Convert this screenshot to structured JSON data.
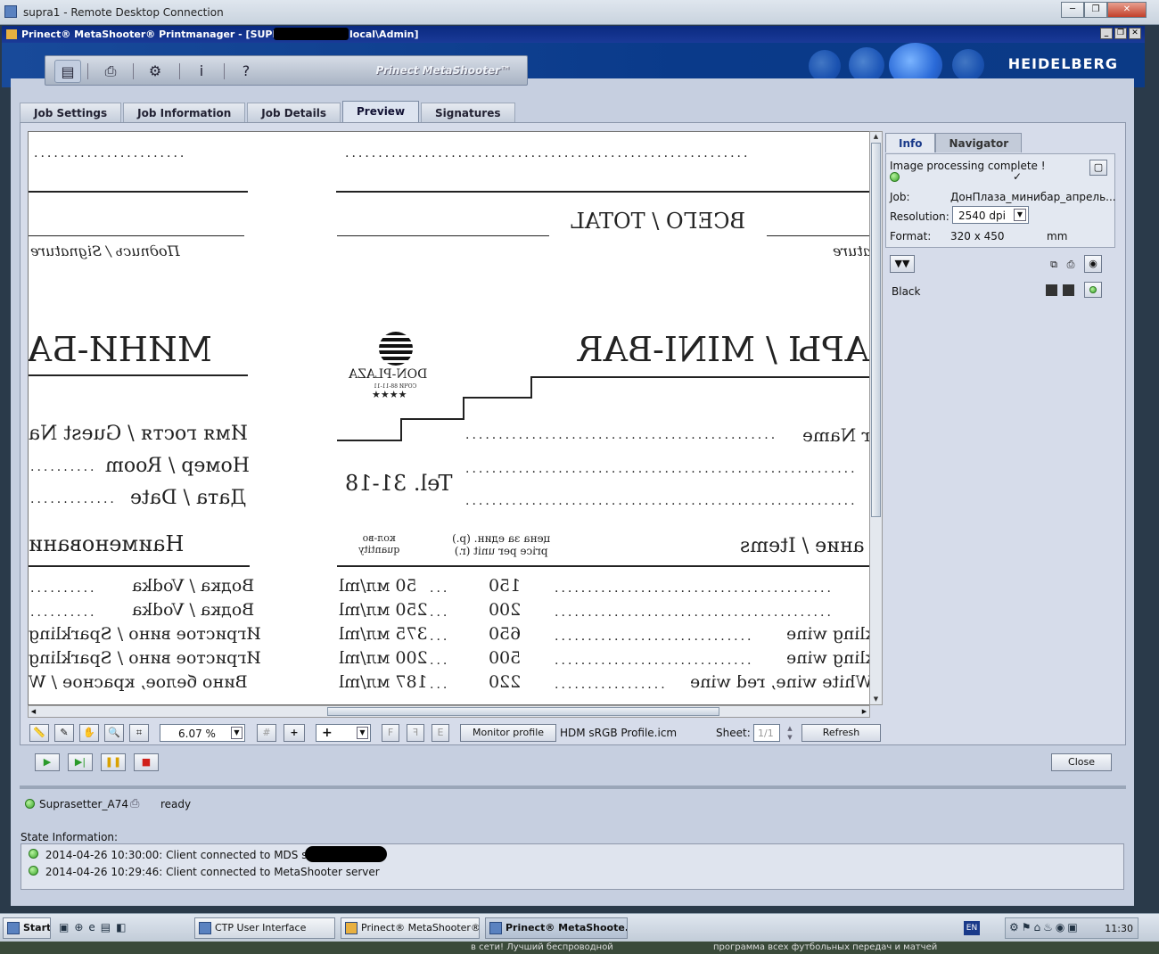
{
  "rdp": {
    "title": "supra1 - Remote Desktop Connection"
  },
  "app": {
    "title": "Prinect® MetaShooter® Printmanager - [SUPRA1/",
    "title_suffix": "local\\Admin]"
  },
  "banner": {
    "brand": "Prinect MetaShooter™",
    "logo": "HEIDELBERG"
  },
  "tabs": [
    "Job Settings",
    "Job Information",
    "Job Details",
    "Preview",
    "Signatures"
  ],
  "active_tab": "Preview",
  "preview_doc": {
    "total": "ВСЕГО / TOTAL",
    "signature": "Подпись / Signature",
    "signature_right": "ature",
    "minibar_left": "МИНИ-БА",
    "minibar_right": "САРЫ / MINI-BAR",
    "logo_text": "DON-PLAZA",
    "logo_sub": "СОЧИ 88-11-11",
    "stars": "★★★★",
    "guest": "Имя гостя / Guest Na",
    "guest_right": "r Name",
    "room": "Номер / Room",
    "date": "Дата / Date",
    "tel": "Tel. 31-18",
    "items_left": "Наименовани",
    "qty_header": [
      "кол-во",
      "quantity"
    ],
    "price_header": [
      "цена за един. (р.)",
      "price per unit (r.)"
    ],
    "items_right": "ание / Items",
    "lines": [
      {
        "left": "Водка / Vodka",
        "qty": "50 мл/ml",
        "price": "150",
        "right": ""
      },
      {
        "left": "Водка / Vodka",
        "qty": "250 мл/ml",
        "price": "200",
        "right": ""
      },
      {
        "left": "Игристое вино / Sparkling",
        "qty": "375 мл/ml",
        "price": "650",
        "right": "kling wine"
      },
      {
        "left": "Игристое вино / Sparkling",
        "qty": "200 мл/ml",
        "price": "500",
        "right": "kling wine"
      },
      {
        "left": "Вино белое, красное / W",
        "qty": "187 мл/ml",
        "price": "220",
        "right": "/ White wine, red wine"
      }
    ]
  },
  "side": {
    "tabs": [
      "Info",
      "Navigator"
    ],
    "status": "Image processing complete !",
    "job_label": "Job:",
    "job_value": "ДонПлаза_минибар_апрель...",
    "res_label": "Resolution:",
    "res_value": "2540 dpi",
    "format_label": "Format:",
    "format_value": "320 x 450",
    "format_unit": "mm",
    "separation": "Black"
  },
  "bottom": {
    "zoom": "6.07 %",
    "monitor_btn": "Monitor profile",
    "profile": "HDM sRGB Profile.icm",
    "sheet_label": "Sheet:",
    "sheet_value": "1/1",
    "refresh": "Refresh",
    "add": "+"
  },
  "close": "Close",
  "device": {
    "name": "Suprasetter_A74",
    "state": "ready"
  },
  "state_label": "State Information:",
  "log": [
    "2014-04-26 10:30:00: Client connected to MDS server",
    "2014-04-26 10:29:46: Client connected to MetaShooter server"
  ],
  "taskbar": {
    "start": "Start",
    "items": [
      "CTP User Interface",
      "Prinect® MetaShooter®...",
      "Prinect® MetaShoote..."
    ],
    "lang": "EN",
    "clock": "11:30"
  },
  "bg_text": [
    "в сети! Лучший беспроводной",
    "программа всех футбольных передач и матчей"
  ],
  "colors": {
    "title_bar": "#0a2a80",
    "panel": "#d6dcea",
    "ok_green": "#3aa52a",
    "accent_blue": "#1a3a8a"
  }
}
